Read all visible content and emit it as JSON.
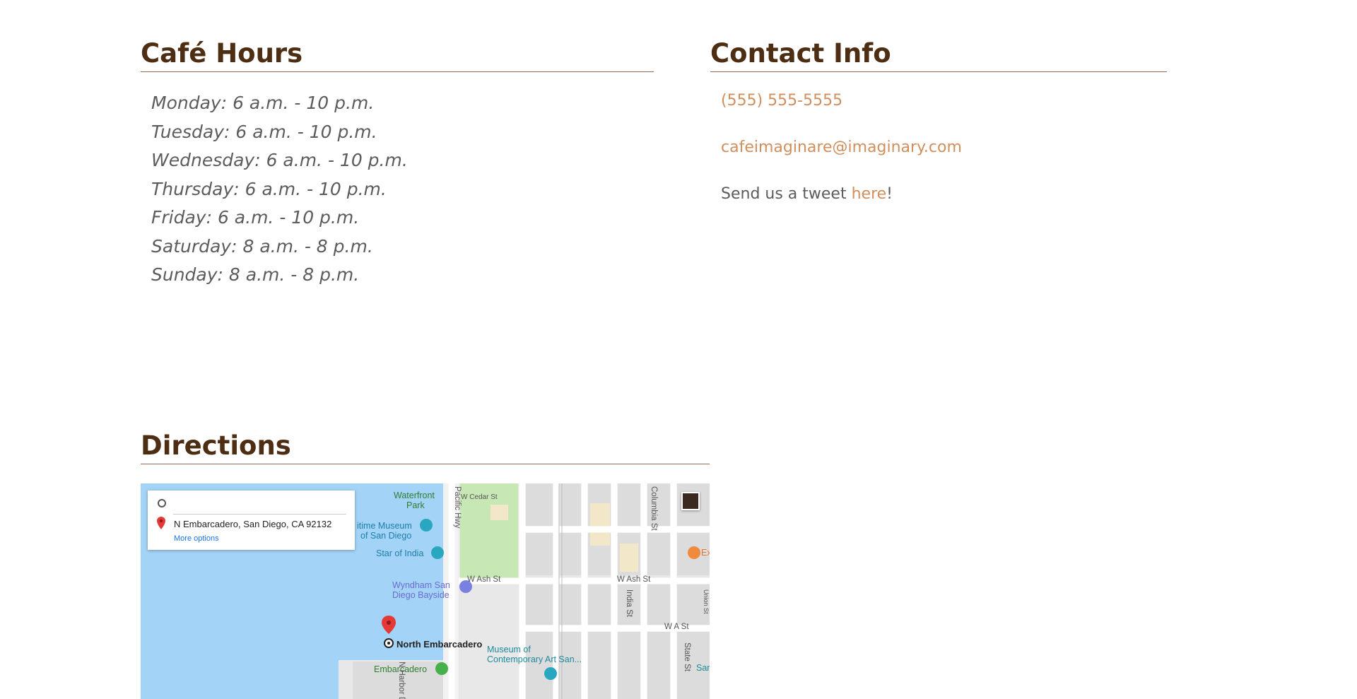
{
  "hours": {
    "heading": "Café Hours",
    "days": [
      "Monday: 6 a.m. - 10 p.m.",
      "Tuesday: 6 a.m. - 10 p.m.",
      "Wednesday: 6 a.m. - 10 p.m.",
      "Thursday: 6 a.m. - 10 p.m.",
      "Friday: 6 a.m. - 10 p.m.",
      "Saturday: 8 a.m. - 8 p.m.",
      "Sunday: 8 a.m. - 8 p.m."
    ]
  },
  "contact": {
    "heading": "Contact Info",
    "phone": "(555) 555-5555",
    "email": "cafeimaginare@imaginary.com",
    "tweet_prefix": "Send us a tweet ",
    "tweet_link": "here",
    "tweet_suffix": "!"
  },
  "directions": {
    "heading": "Directions",
    "map": {
      "destination": "N Embarcadero, San Diego, CA 92132",
      "more_options": "More options",
      "labels": {
        "waterfront_park_1": "Waterfront",
        "waterfront_park_2": "Park",
        "maritime_1": "itime Museum",
        "maritime_2": "of San Diego",
        "star_of_india": "Star of India",
        "wyndham_1": "Wyndham San",
        "wyndham_2": "Diego Bayside",
        "north_embarcadero": "North Embarcadero",
        "embarcadero": "Embarcadero",
        "museum_1": "Museum of",
        "museum_2": "Contemporary Art San...",
        "w_cedar_st": "W Cedar St",
        "w_ash_st_1": "W Ash St",
        "w_ash_st_2": "W Ash St",
        "w_a_st": "W A St",
        "pacific_hwy": "Pacific Hwy",
        "columbia_st": "Columbia St",
        "india_st": "India St",
        "state_st": "State St",
        "union_st": "Union St",
        "n_harbor": "N Harbor D",
        "ex": "Ex",
        "san": "San"
      },
      "colors": {
        "water": "#a3d3f7",
        "park": "#c7e8b4",
        "road": "#ffffff",
        "pin": "#e53935"
      }
    }
  }
}
